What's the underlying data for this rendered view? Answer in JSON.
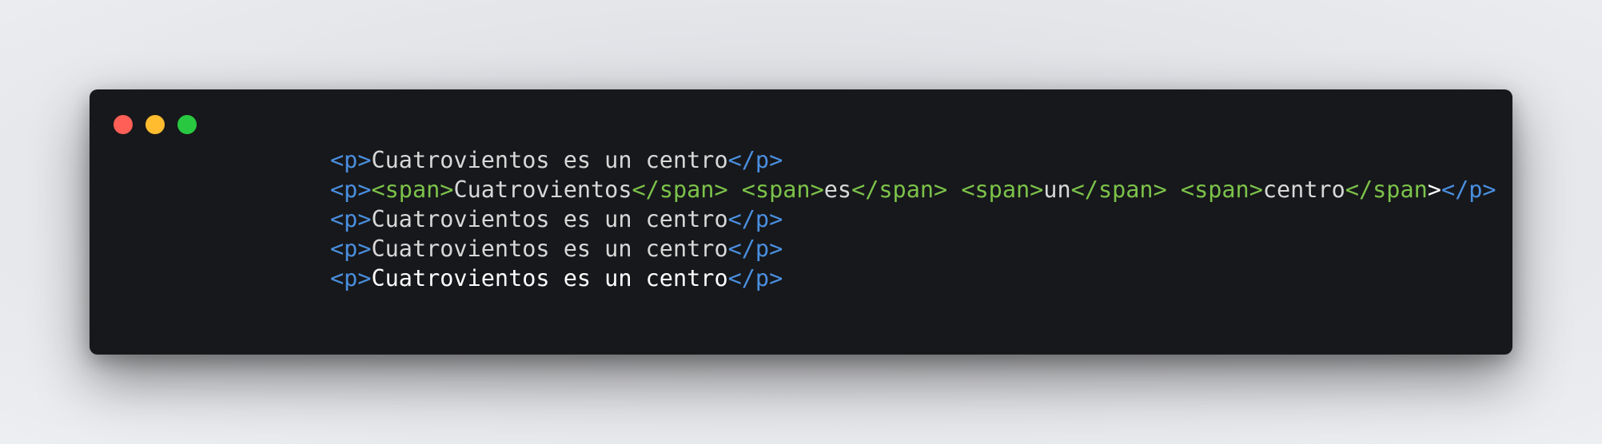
{
  "window": {
    "controls": {
      "close_color": "#ff5f57",
      "minimize_color": "#febc2e",
      "maximize_color": "#28c840"
    }
  },
  "code": {
    "colors": {
      "p_tag": "#4a8fe0",
      "span_tag": "#7cc34a",
      "text": "#d8d8d8",
      "text_bright": "#ffffff"
    },
    "lines": [
      {
        "open": "<p>",
        "text": "Cuatrovientos es un centro",
        "close": "</p>"
      },
      {
        "open": "<p>",
        "spans": [
          {
            "open": "<span>",
            "text": "Cuatrovientos",
            "close": "</span>",
            "sep": " "
          },
          {
            "open": "<span>",
            "text": "es",
            "close": "</span>",
            "sep": " "
          },
          {
            "open": "<span>",
            "text": "un",
            "close": "</span>",
            "sep": " "
          },
          {
            "open": "<span>",
            "text": "centro",
            "close": "</span",
            "sep": ""
          }
        ],
        "stray": ">",
        "close": "</p>"
      },
      {
        "open": "<p>",
        "text": "Cuatrovientos es un centro",
        "close": "</p>"
      },
      {
        "open": "<p>",
        "text": "Cuatrovientos es un centro",
        "close": "</p>"
      },
      {
        "open": "<p>",
        "text": "Cuatrovientos es un centro",
        "close": "</p>"
      }
    ]
  }
}
